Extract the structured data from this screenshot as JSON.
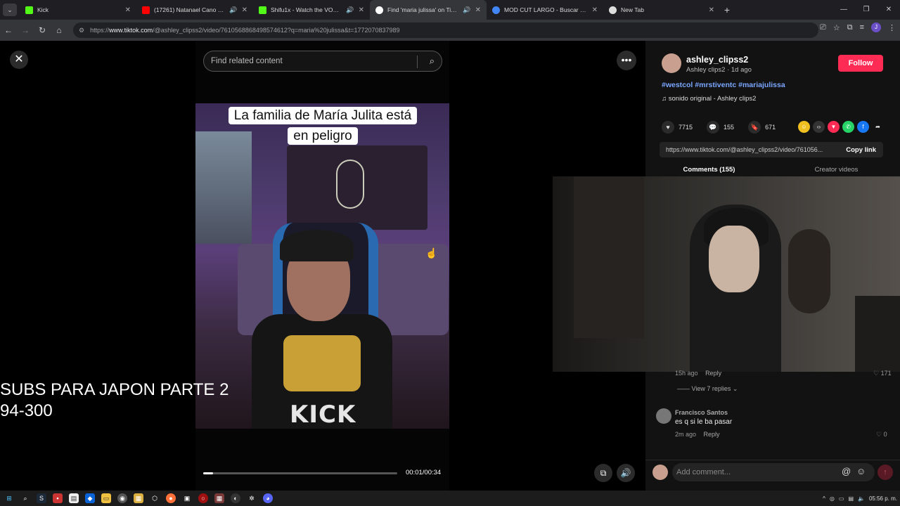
{
  "browser": {
    "tabs": [
      {
        "title": "Kick",
        "favicon_color": "#53fc18",
        "audio": false
      },
      {
        "title": "(17261) Natanael Cano x Dan Sanchez",
        "favicon_color": "#ff0000",
        "audio": true
      },
      {
        "title": "Shifu1x - Watch the VOD on Kick",
        "favicon_color": "#53fc18",
        "audio": true
      },
      {
        "title": "Find 'maria julissa' on TikTok",
        "favicon_color": "#ffffff",
        "audio": true,
        "active": true
      },
      {
        "title": "MOD CUT LARGO - Buscar con Google",
        "favicon_color": "#4285f4",
        "audio": false
      },
      {
        "title": "New Tab",
        "favicon_color": "#dddddd",
        "audio": false
      }
    ],
    "url_prefix": "https://",
    "url_host": "www.tiktok.com",
    "url_path": "/@ashley_clipss2/video/7610568868498574612?q=maria%20julissa&t=1772070837989",
    "profile_initial": "J"
  },
  "player": {
    "search_placeholder": "Find related content",
    "caption_line1": "La familia de María Julita está",
    "caption_line2": "en peligro",
    "watermark": "KICK",
    "progress": 0.05,
    "time": "00:01/00:34"
  },
  "overlay": {
    "subs_line1": "SUBS PARA JAPON PARTE 2",
    "subs_line2": "94-300"
  },
  "author": {
    "username": "ashley_clipss2",
    "subtitle": "Ashley clips2 · 1d ago",
    "follow_label": "Follow",
    "hashtags": "#westcol #mrstiventc #mariajulissa",
    "sound": "sonido original - Ashley clips2"
  },
  "stats": {
    "likes": "7715",
    "comments": "155",
    "saves": "671"
  },
  "share": {
    "link": "https://www.tiktok.com/@ashley_clipss2/video/761056...",
    "copy_label": "Copy link"
  },
  "comments_tabs": {
    "comments": "Comments (155)",
    "creator": "Creator videos"
  },
  "comments": {
    "first_meta_time": "15h ago",
    "first_reply": "Reply",
    "first_likes": "171",
    "view_replies": "View 7 replies",
    "second_author": "Francisco Santos",
    "second_text": "es q si le ba pasar",
    "second_time": "2m ago",
    "second_reply": "Reply",
    "second_likes": "0"
  },
  "composer": {
    "placeholder": "Add comment..."
  },
  "taskbar": {
    "time": "05:56 p. m."
  }
}
